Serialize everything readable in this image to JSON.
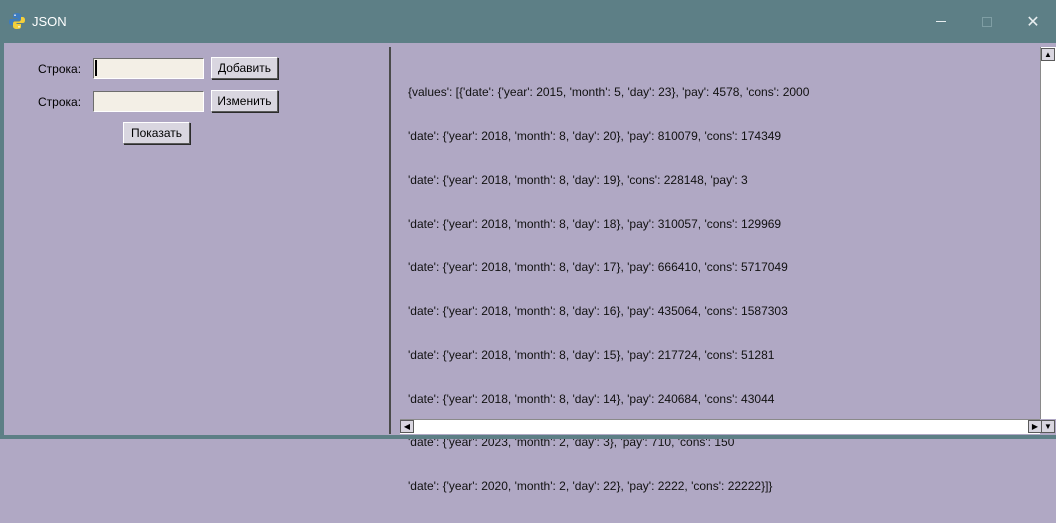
{
  "window": {
    "title": "JSON",
    "minimize_glyph": "—",
    "close_glyph": "✕"
  },
  "form": {
    "row1_label": "Строка:",
    "row1_value": "",
    "row2_label": "Строка:",
    "row2_value": "",
    "add_button": "Добавить",
    "edit_button": "Изменить",
    "show_button": "Показать"
  },
  "output": {
    "lines": [
      "{values': [{'date': {'year': 2015, 'month': 5, 'day': 23}, 'pay': 4578, 'cons': 2000",
      "'date': {'year': 2018, 'month': 8, 'day': 20}, 'pay': 810079, 'cons': 174349",
      "'date': {'year': 2018, 'month': 8, 'day': 19}, 'cons': 228148, 'pay': 3",
      "'date': {'year': 2018, 'month': 8, 'day': 18}, 'pay': 310057, 'cons': 129969",
      "'date': {'year': 2018, 'month': 8, 'day': 17}, 'pay': 666410, 'cons': 5717049",
      "'date': {'year': 2018, 'month': 8, 'day': 16}, 'pay': 435064, 'cons': 1587303",
      "'date': {'year': 2018, 'month': 8, 'day': 15}, 'pay': 217724, 'cons': 51281",
      "'date': {'year': 2018, 'month': 8, 'day': 14}, 'pay': 240684, 'cons': 43044",
      "'date': {'year': 2023, 'month': 2, 'day': 3}, 'pay': 710, 'cons': 150",
      "'date': {'year': 2020, 'month': 2, 'day': 22}, 'pay': 2222, 'cons': 22222}]}"
    ]
  },
  "icons": {
    "app": "python-logo-icon",
    "scroll_up": "arrow-up-icon",
    "scroll_left": "arrow-left-icon",
    "scroll_right": "arrow-right-icon",
    "scroll_down": "arrow-down-icon"
  },
  "colors": {
    "titlebar": "#5d7f86",
    "background": "#b0a8c4",
    "entry": "#f3efe6"
  }
}
